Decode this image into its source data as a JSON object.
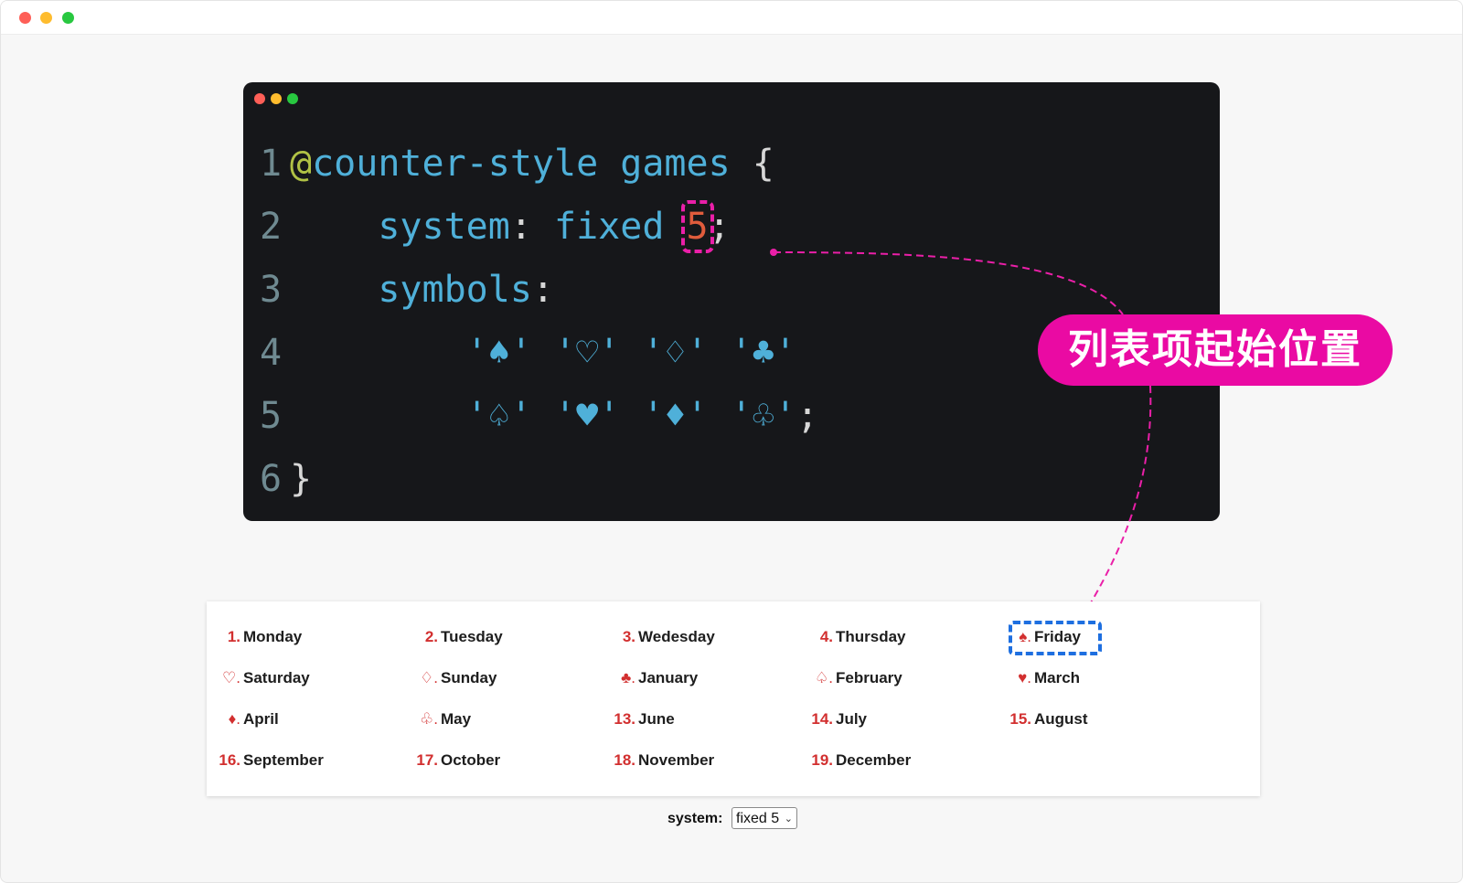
{
  "window": {
    "colors": {
      "close": "#fe5f57",
      "minimize": "#febc2e",
      "zoom": "#28c840"
    }
  },
  "code": {
    "line_numbers": [
      "1",
      "2",
      "3",
      "4",
      "5",
      "6"
    ],
    "at": "@",
    "rule": "counter-style",
    "name": "games",
    "open_brace": "{",
    "system_prop": "system",
    "colon": ":",
    "system_value": "fixed",
    "system_start": "5",
    "semicolon": ";",
    "symbols_prop": "symbols",
    "symbols_row1": [
      "'♠'",
      "'♡'",
      "'♢'",
      "'♣'"
    ],
    "symbols_row2": [
      "'♤'",
      "'♥'",
      "'♦'",
      "'♧'"
    ],
    "close_brace": "}"
  },
  "callout": {
    "text": "列表项起始位置",
    "color": "#ea0aa3"
  },
  "list": [
    {
      "marker": "1.",
      "label": "Monday"
    },
    {
      "marker": "2.",
      "label": "Tuesday"
    },
    {
      "marker": "3.",
      "label": "Wedesday"
    },
    {
      "marker": "4.",
      "label": "Thursday"
    },
    {
      "marker": "♠.",
      "label": "Friday"
    },
    {
      "marker": "♡.",
      "label": "Saturday"
    },
    {
      "marker": "♢.",
      "label": "Sunday"
    },
    {
      "marker": "♣.",
      "label": "January"
    },
    {
      "marker": "♤.",
      "label": "February"
    },
    {
      "marker": "♥.",
      "label": "March"
    },
    {
      "marker": "♦.",
      "label": "April"
    },
    {
      "marker": "♧.",
      "label": "May"
    },
    {
      "marker": "13.",
      "label": "June"
    },
    {
      "marker": "14.",
      "label": "July"
    },
    {
      "marker": "15.",
      "label": "August"
    },
    {
      "marker": "16.",
      "label": "September"
    },
    {
      "marker": "17.",
      "label": "October"
    },
    {
      "marker": "18.",
      "label": "November"
    },
    {
      "marker": "19.",
      "label": "December"
    }
  ],
  "control": {
    "label": "system:",
    "selected": "fixed 5"
  }
}
